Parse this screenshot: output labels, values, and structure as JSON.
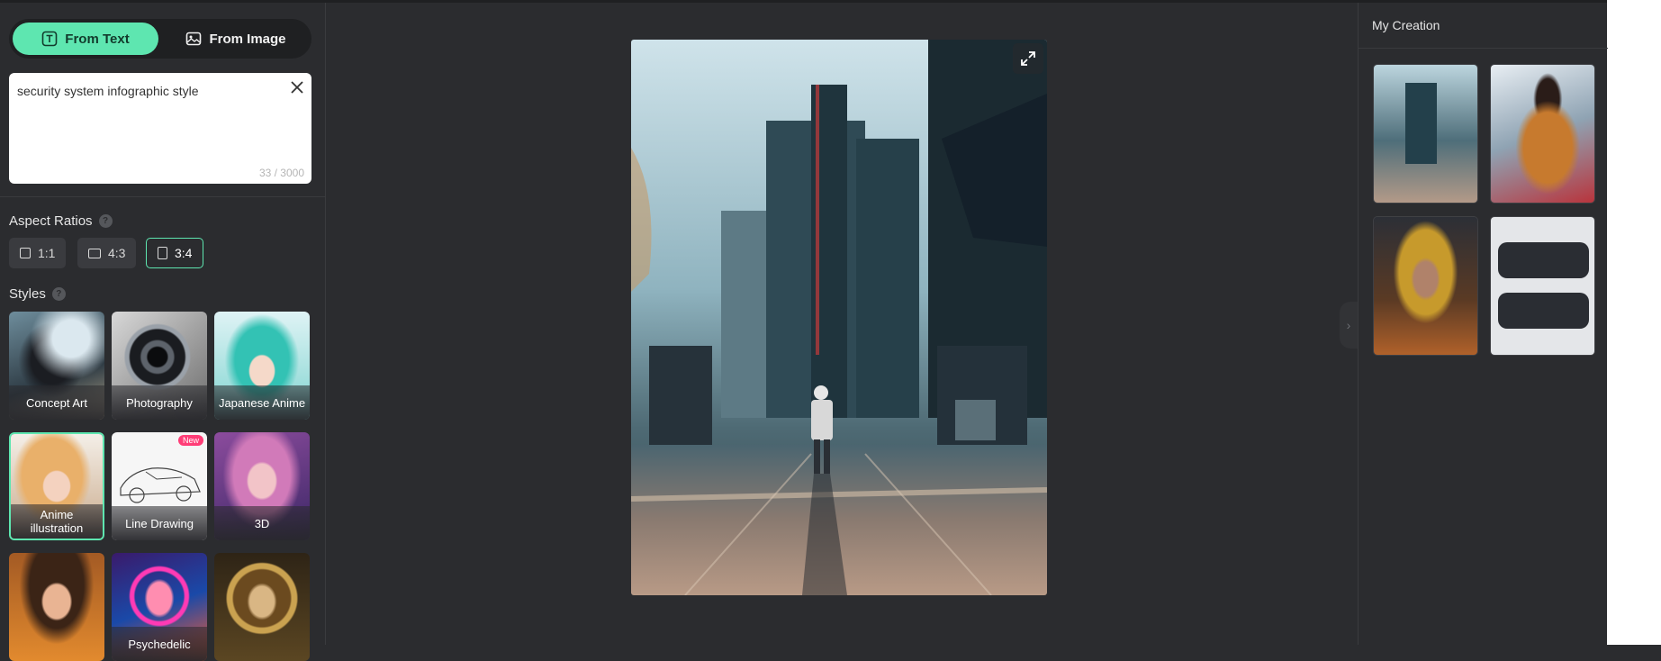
{
  "mode_tabs": {
    "from_text": "From Text",
    "from_image": "From Image",
    "active": "from_text"
  },
  "prompt": {
    "value": "security system infographic style",
    "counter": "33 / 3000"
  },
  "aspect_ratios": {
    "title": "Aspect Ratios",
    "options": [
      "1:1",
      "4:3",
      "3:4"
    ],
    "selected": "3:4"
  },
  "styles": {
    "title": "Styles",
    "items": [
      {
        "label": "Concept Art"
      },
      {
        "label": "Photography"
      },
      {
        "label": "Japanese Anime"
      },
      {
        "label": "Anime illustration",
        "selected": true
      },
      {
        "label": "Line Drawing",
        "badge": "New"
      },
      {
        "label": "3D"
      },
      {
        "label": ""
      },
      {
        "label": "Psychedelic"
      },
      {
        "label": ""
      }
    ]
  },
  "right_panel": {
    "title": "My Creation"
  },
  "colors": {
    "accent": "#5ee6b0",
    "badge": "#ff3d77",
    "bg": "#2b2c2f"
  }
}
